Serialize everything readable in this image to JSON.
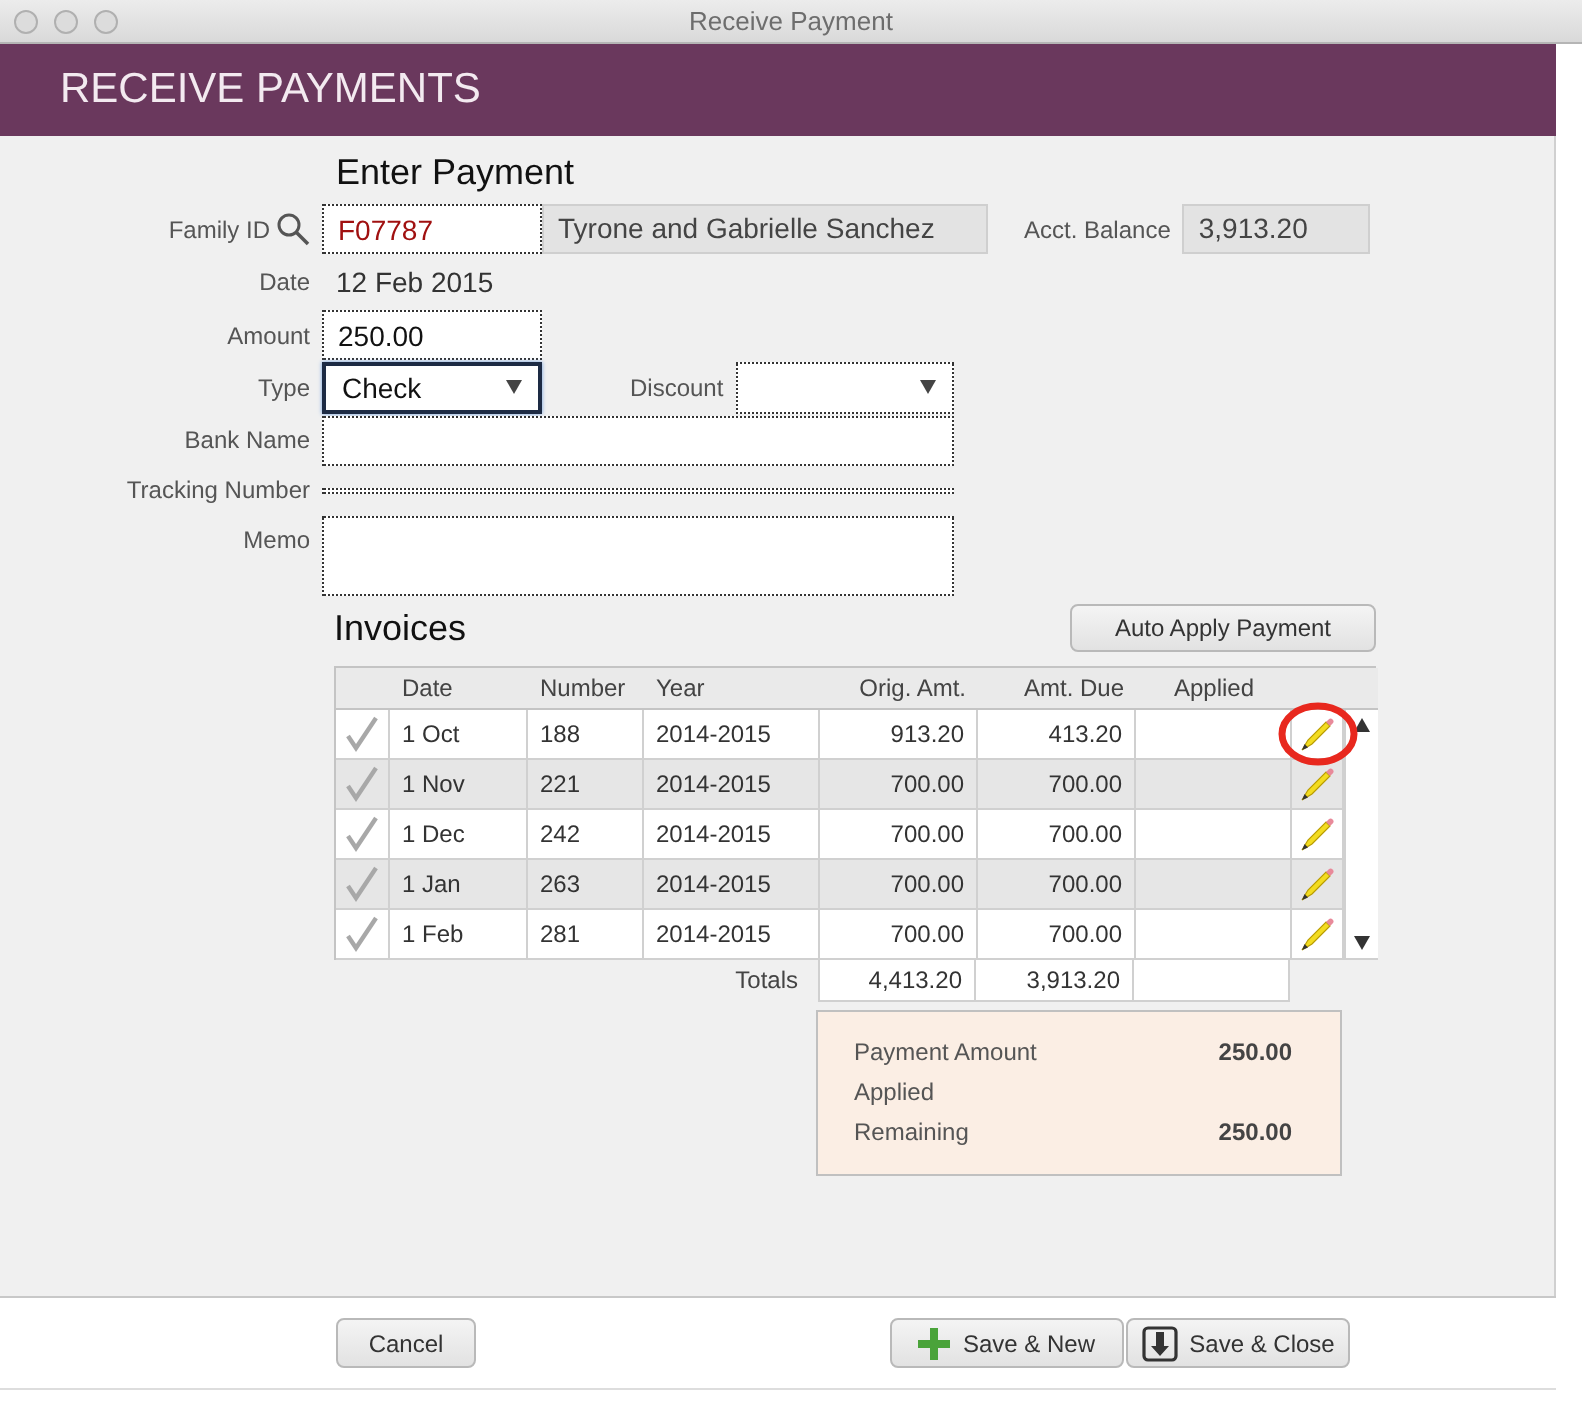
{
  "window": {
    "title": "Receive Payment"
  },
  "header": {
    "title": "RECEIVE PAYMENTS"
  },
  "payment": {
    "heading": "Enter Payment",
    "family_id": {
      "label": "Family ID",
      "value": "F07787"
    },
    "family_name": "Tyrone and Gabrielle Sanchez",
    "balance": {
      "label": "Acct. Balance",
      "value": "3,913.20"
    },
    "date": {
      "label": "Date",
      "value": "12 Feb 2015"
    },
    "amount": {
      "label": "Amount",
      "value": "250.00"
    },
    "type": {
      "label": "Type",
      "value": "Check",
      "focused": true
    },
    "discount": {
      "label": "Discount"
    },
    "bank_name": {
      "label": "Bank Name"
    },
    "tracking_number": {
      "label": "Tracking Number"
    },
    "memo": {
      "label": "Memo"
    }
  },
  "invoices": {
    "heading": "Invoices",
    "auto_apply_button": "Auto Apply Payment",
    "columns": [
      "Date",
      "Number",
      "Year",
      "Orig. Amt.",
      "Amt. Due",
      "Applied"
    ],
    "rows": [
      {
        "date": "1 Oct",
        "number": "188",
        "year": "2014-2015",
        "orig_amt": "913.20",
        "amt_due": "413.20",
        "checked": false,
        "highlighted": true
      },
      {
        "date": "1 Nov",
        "number": "221",
        "year": "2014-2015",
        "orig_amt": "700.00",
        "amt_due": "700.00",
        "checked": false,
        "highlighted": false
      },
      {
        "date": "1 Dec",
        "number": "242",
        "year": "2014-2015",
        "orig_amt": "700.00",
        "amt_due": "700.00",
        "checked": false,
        "highlighted": false
      },
      {
        "date": "1 Jan",
        "number": "263",
        "year": "2014-2015",
        "orig_amt": "700.00",
        "amt_due": "700.00",
        "checked": false,
        "highlighted": false
      },
      {
        "date": "1 Feb",
        "number": "281",
        "year": "2014-2015",
        "orig_amt": "700.00",
        "amt_due": "700.00",
        "checked": false,
        "highlighted": false
      }
    ],
    "totals": {
      "label": "Totals",
      "orig_amt": "4,413.20",
      "amt_due": "3,913.20"
    }
  },
  "summary": [
    {
      "label": "Payment Amount",
      "value": "250.00"
    },
    {
      "label": "Applied"
    },
    {
      "label": "Remaining",
      "value": "250.00"
    }
  ],
  "buttons": [
    {
      "label": "Cancel",
      "kind": "plain"
    },
    {
      "label": "Save & New",
      "kind": "add"
    },
    {
      "label": "Save & Close",
      "kind": "save"
    }
  ]
}
